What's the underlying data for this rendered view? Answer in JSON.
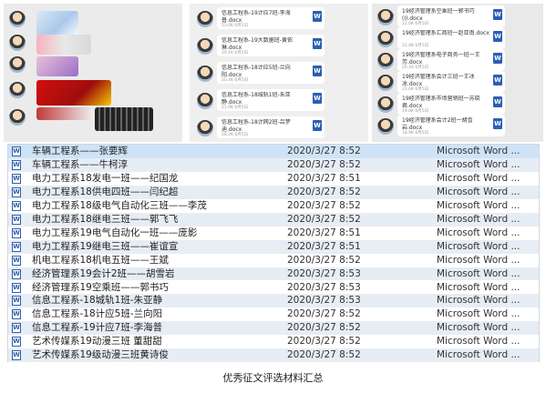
{
  "collage": {
    "middle_bubbles": [
      {
        "name": "信息工程系-19计应7班-李海普.docx",
        "size": "23.0K 6月5日"
      },
      {
        "name": "信息工程系-19大数据班-黄依琳.docx",
        "size": "19.1K 6月5日"
      },
      {
        "name": "信息工程系-18计应5班-兰向阳.docx",
        "size": "20.4K 6月5日"
      },
      {
        "name": "信息工程系-18城轨1班-朱亚静.docx",
        "size": "21.0K 6月5日"
      },
      {
        "name": "信息工程系-18计网2班-吕梦迪.docx",
        "size": "18.2K 6月5日"
      }
    ],
    "right_bubbles": [
      {
        "name": "19经济管理系空乘班一郭书巧(I).docx",
        "size": "22.0K 6月5日"
      },
      {
        "name": "19经济管理系汇商班一赵亚南.docx",
        "size": "21.4K 6月5日"
      },
      {
        "name": "19经济管理系电子商务一班一王芳.docx",
        "size": "20.1K 6月5日"
      },
      {
        "name": "19经济管理系会计三班一王冰冰.docx",
        "size": "23.6K 6月5日"
      },
      {
        "name": "19经济管理系市场营销班一苏晓君.docx",
        "size": "19.8K 6月5日"
      },
      {
        "name": "19经济管理系会计2班一胡雪岩.docx",
        "size": "18.9K 6月5日"
      }
    ]
  },
  "files": [
    {
      "name": "车辆工程系——张要辉",
      "date": "2020/3/27 8:52",
      "type": "Microsoft Word ..."
    },
    {
      "name": "车辆工程系——牛柯淳",
      "date": "2020/3/27 8:52",
      "type": "Microsoft Word ..."
    },
    {
      "name": "电力工程系18发电一班——纪国龙",
      "date": "2020/3/27 8:51",
      "type": "Microsoft Word ..."
    },
    {
      "name": "电力工程系18供电四班——闫纪超",
      "date": "2020/3/27 8:52",
      "type": "Microsoft Word ..."
    },
    {
      "name": "电力工程系18级电气自动化三班——李茂",
      "date": "2020/3/27 8:52",
      "type": "Microsoft Word ..."
    },
    {
      "name": "电力工程系18继电三班——郭飞飞",
      "date": "2020/3/27 8:52",
      "type": "Microsoft Word ..."
    },
    {
      "name": "电力工程系19电气自动化一班——庞影",
      "date": "2020/3/27 8:51",
      "type": "Microsoft Word ..."
    },
    {
      "name": "电力工程系19继电三班——崔谊宣",
      "date": "2020/3/27 8:51",
      "type": "Microsoft Word ..."
    },
    {
      "name": "机电工程系18机电五班——王斌",
      "date": "2020/3/27 8:52",
      "type": "Microsoft Word ..."
    },
    {
      "name": "经济管理系19会计2班——胡雪岩",
      "date": "2020/3/27 8:53",
      "type": "Microsoft Word ..."
    },
    {
      "name": "经济管理系19空乘班——郭书巧",
      "date": "2020/3/27 8:53",
      "type": "Microsoft Word ..."
    },
    {
      "name": "信息工程系-18城轨1班-朱亚静",
      "date": "2020/3/27 8:53",
      "type": "Microsoft Word ..."
    },
    {
      "name": "信息工程系-18计应5班-兰向阳",
      "date": "2020/3/27 8:52",
      "type": "Microsoft Word ..."
    },
    {
      "name": "信息工程系-19计应7班-李海普",
      "date": "2020/3/27 8:52",
      "type": "Microsoft Word ..."
    },
    {
      "name": "艺术传媒系19动漫三班 董甜甜",
      "date": "2020/3/27 8:52",
      "type": "Microsoft Word ..."
    },
    {
      "name": "艺术传媒系19级动漫三班黄诗俊",
      "date": "2020/3/27 8:52",
      "type": "Microsoft Word ..."
    }
  ],
  "caption": "优秀征文评选材料汇总"
}
